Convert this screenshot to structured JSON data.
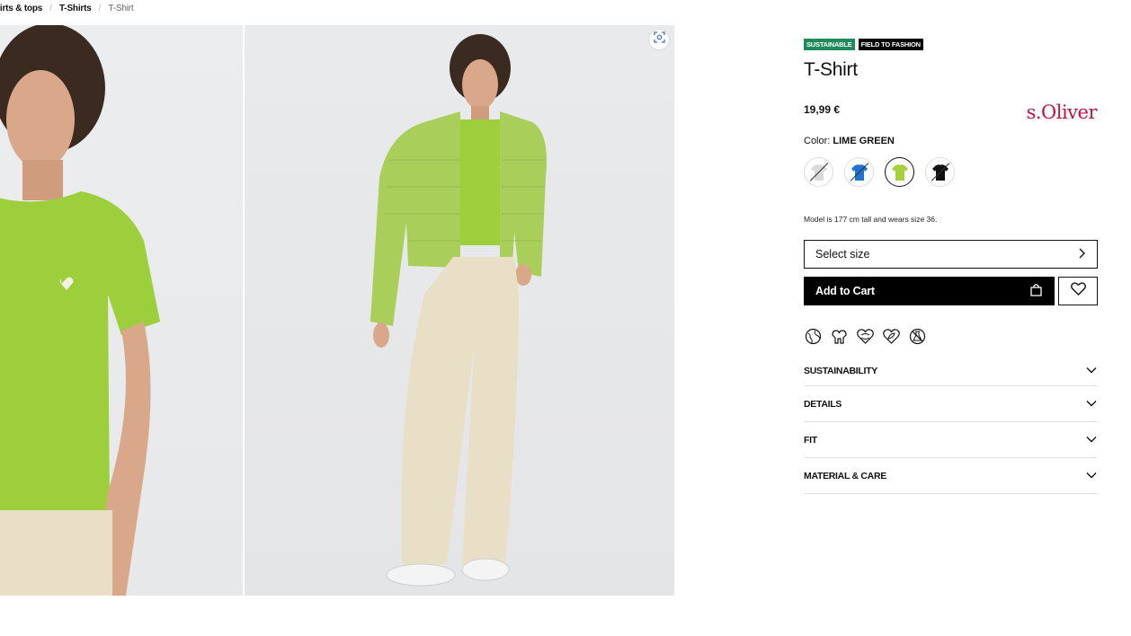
{
  "breadcrumb": {
    "items": [
      {
        "label": "hirts & tops"
      },
      {
        "label": "T-Shirts"
      },
      {
        "label": "T-Shirt"
      }
    ],
    "separator": "/"
  },
  "product": {
    "badges": [
      "SUSTAINABLE",
      "FIELD TO FASHION"
    ],
    "title": "T-Shirt",
    "price": "19,99 €",
    "brand": "s.Oliver",
    "color_label": "Color:",
    "color_value": "LIME GREEN",
    "swatches": [
      {
        "color": "#d9d9d9",
        "available": false
      },
      {
        "color": "#1f72d6",
        "available": false
      },
      {
        "color": "#a6cf3c",
        "available": true,
        "selected": true
      },
      {
        "color": "#111111",
        "available": false
      }
    ],
    "model_note": "Model is 177 cm tall and wears size 36.",
    "size_select_label": "Select size",
    "add_to_cart_label": "Add to Cart"
  },
  "accordion": {
    "items": [
      {
        "label": "SUSTAINABILITY"
      },
      {
        "label": "DETAILS"
      },
      {
        "label": "FIT"
      },
      {
        "label": "MATERIAL & CARE"
      }
    ]
  },
  "icons": {
    "zoom": "zoom-icon",
    "chevron_right": "chevron-right-icon",
    "bag": "shopping-bag-icon",
    "heart": "heart-icon",
    "chevron_down": "chevron-down-icon",
    "sustainability": [
      "globe-icon",
      "hands-icon",
      "recycle-heart-icon",
      "leaf-heart-icon",
      "no-chemical-icon"
    ]
  },
  "colors": {
    "accent_brand": "#c4123a",
    "badge_green": "#1f8a5c",
    "tshirt_green": "#9ccf3b",
    "pants_cream": "#e9dfc6"
  }
}
